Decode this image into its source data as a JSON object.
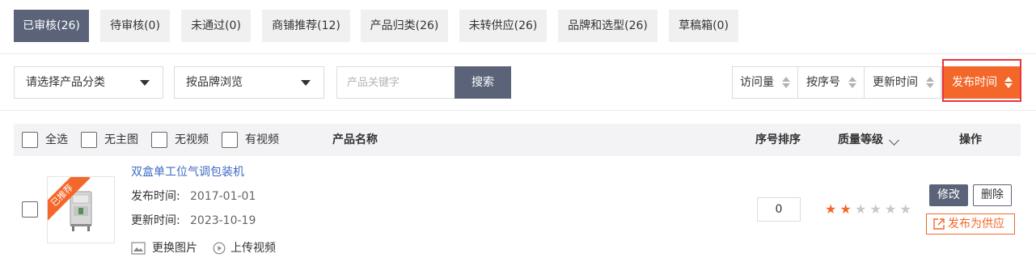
{
  "tabs": [
    {
      "label": "已审核(26)"
    },
    {
      "label": "待审核(0)"
    },
    {
      "label": "未通过(0)"
    },
    {
      "label": "商铺推荐(12)"
    },
    {
      "label": "产品归类(26)"
    },
    {
      "label": "未转供应(26)"
    },
    {
      "label": "品牌和选型(26)"
    },
    {
      "label": "草稿箱(0)"
    }
  ],
  "filters": {
    "category_select": "请选择产品分类",
    "brand_select": "按品牌浏览",
    "search_placeholder": "产品关键字",
    "search_button": "搜索"
  },
  "sort": {
    "views": "访问量",
    "order": "按序号",
    "updated": "更新时间",
    "published": "发布时间"
  },
  "table": {
    "select_all": "全选",
    "no_main_image": "无主图",
    "no_video": "无视频",
    "has_video": "有视频",
    "col_name": "产品名称",
    "col_order": "序号排序",
    "col_quality": "质量等级",
    "col_actions": "操作"
  },
  "rows": [
    {
      "badge": "已推荐",
      "name": "双盒单工位气调包装机",
      "publish_label": "发布时间:",
      "publish_date": "2017-01-01",
      "update_label": "更新时间:",
      "update_date": "2023-10-19",
      "replace_image": "更换图片",
      "upload_video": "上传视频",
      "order": "0",
      "quality_stars": 2,
      "quality_max": 6,
      "edit": "修改",
      "delete": "删除",
      "publish_supply": "发布为供应"
    }
  ],
  "colors": {
    "accent": "#f4672a",
    "tab_active": "#5a6378",
    "link": "#3d6bc4",
    "highlight": "#e8353b"
  }
}
